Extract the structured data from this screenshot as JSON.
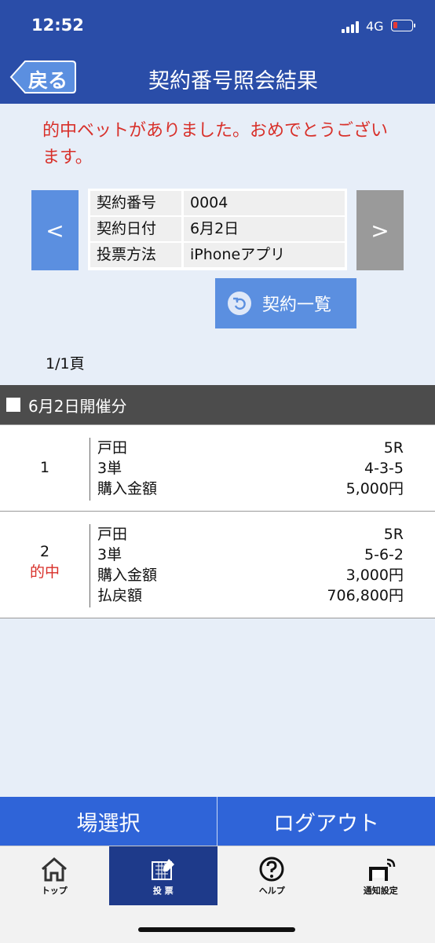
{
  "status": {
    "time": "12:52",
    "network": "4G"
  },
  "nav": {
    "back_label": "戻る",
    "title": "契約番号照会結果"
  },
  "message": "的中ベットがありました。おめでとうございます。",
  "pager": {
    "prev": "<",
    "next": ">",
    "page": "1/1頁"
  },
  "info": [
    {
      "key": "契約番号",
      "value": "0004"
    },
    {
      "key": "契約日付",
      "value": "6月2日"
    },
    {
      "key": "投票方法",
      "value": "iPhoneアプリ"
    }
  ],
  "list_button": "契約一覧",
  "section_title": "6月2日開催分",
  "bets": [
    {
      "number": "1",
      "hit": "",
      "lines": [
        {
          "label": "戸田",
          "value": "5R"
        },
        {
          "label": "3単",
          "value": "4-3-5"
        },
        {
          "label": "購入金額",
          "value": "5,000円"
        }
      ]
    },
    {
      "number": "2",
      "hit": "的中",
      "lines": [
        {
          "label": "戸田",
          "value": "5R"
        },
        {
          "label": "3単",
          "value": "5-6-2"
        },
        {
          "label": "購入金額",
          "value": "3,000円"
        },
        {
          "label": "払戻額",
          "value": "706,800円"
        }
      ]
    }
  ],
  "actions": {
    "left": "場選択",
    "right": "ログアウト"
  },
  "tabs": [
    {
      "label": "トップ",
      "icon": "home-icon",
      "active": false
    },
    {
      "label": "投 票",
      "icon": "ballot-icon",
      "active": true
    },
    {
      "label": "ヘルプ",
      "icon": "help-icon",
      "active": false
    },
    {
      "label": "通知設定",
      "icon": "notification-icon",
      "active": false
    }
  ],
  "colors": {
    "header": "#2a4da8",
    "accent": "#5b8fe0",
    "hit": "#d8302a",
    "action": "#2f64d8"
  }
}
